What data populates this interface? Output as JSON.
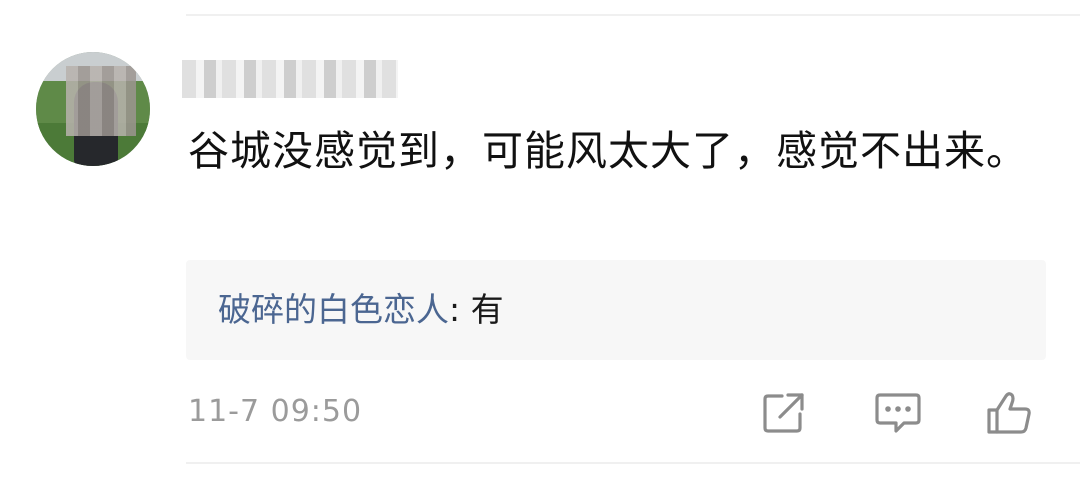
{
  "comment": {
    "username": "",
    "text": "谷城没感觉到，可能风太大了，感觉不出来。"
  },
  "reply": {
    "author": "破碎的白色恋人",
    "separator": ": ",
    "content": "有"
  },
  "timestamp": "11-7 09:50",
  "actions": {
    "share_icon": "share-icon",
    "comment_icon": "comment-icon",
    "like_icon": "thumbs-up-icon"
  },
  "colors": {
    "reply_author": "#4b6691",
    "timestamp": "#9b9b9b",
    "reply_bg": "#f7f7f7",
    "icon": "#8c8c8c"
  }
}
